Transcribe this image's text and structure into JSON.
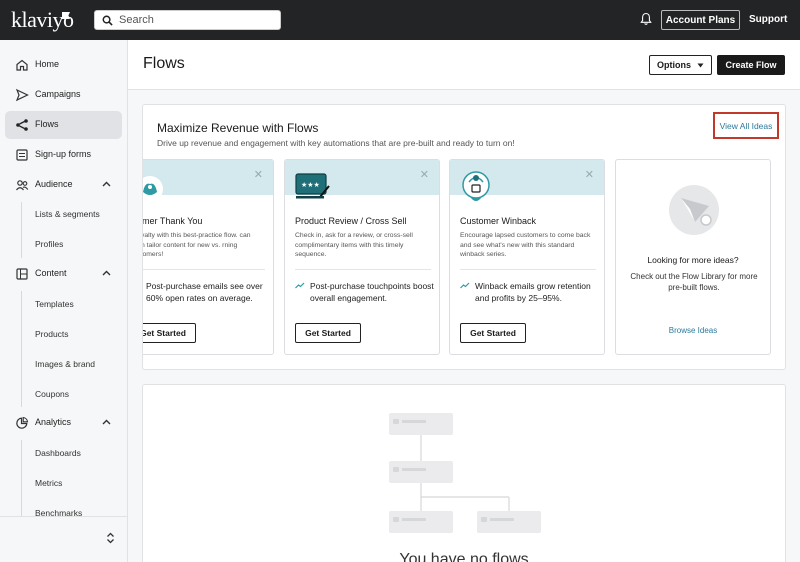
{
  "topbar": {
    "logo": "klaviyo",
    "search_placeholder": "Search",
    "account_plans": "Account Plans",
    "support": "Support"
  },
  "sidebar": {
    "items": [
      {
        "label": "Home",
        "icon": "home-icon"
      },
      {
        "label": "Campaigns",
        "icon": "send-icon"
      },
      {
        "label": "Flows",
        "icon": "flows-icon",
        "active": true
      },
      {
        "label": "Sign-up forms",
        "icon": "form-icon"
      },
      {
        "label": "Audience",
        "icon": "audience-icon",
        "expanded": true
      },
      {
        "label": "Content",
        "icon": "content-icon",
        "expanded": true
      },
      {
        "label": "Analytics",
        "icon": "analytics-icon",
        "expanded": true
      }
    ],
    "audience_sub": [
      "Lists & segments",
      "Profiles"
    ],
    "content_sub": [
      "Templates",
      "Products",
      "Images & brand",
      "Coupons"
    ],
    "analytics_sub": [
      "Dashboards",
      "Metrics",
      "Benchmarks"
    ]
  },
  "header": {
    "title": "Flows",
    "options_label": "Options",
    "create_label": "Create Flow"
  },
  "ideas": {
    "title": "Maximize Revenue with Flows",
    "subtitle": "Drive up revenue and engagement with key automations that are pre-built and ready to turn on!",
    "view_all": "View All Ideas",
    "cards": [
      {
        "title": "stomer Thank You",
        "desc": "d loyalty with this best-practice flow. can even tailor content for new vs. rning customers!",
        "stat": "Post-purchase emails see over 60% open rates on average.",
        "button": "Get Started"
      },
      {
        "title": "Product Review / Cross Sell",
        "desc": "Check in, ask for a review, or cross-sell complimentary items with this timely sequence.",
        "stat": "Post-purchase touchpoints boost overall engagement.",
        "button": "Get Started"
      },
      {
        "title": "Customer Winback",
        "desc": "Encourage lapsed customers to come back and see what's new with this standard winback series.",
        "stat": "Winback emails grow retention and profits by 25–95%.",
        "button": "Get Started"
      }
    ],
    "more": {
      "title": "Looking for more ideas?",
      "desc": "Check out the Flow Library for more pre-built flows.",
      "link": "Browse Ideas"
    }
  },
  "empty": {
    "message": "You have no flows"
  },
  "colors": {
    "topbar": "#232426",
    "accent_link": "#2b7a9b",
    "highlight_border": "#c0392b",
    "card_banner": "#d3e9ee",
    "teal_icon": "#2e9aa3"
  }
}
